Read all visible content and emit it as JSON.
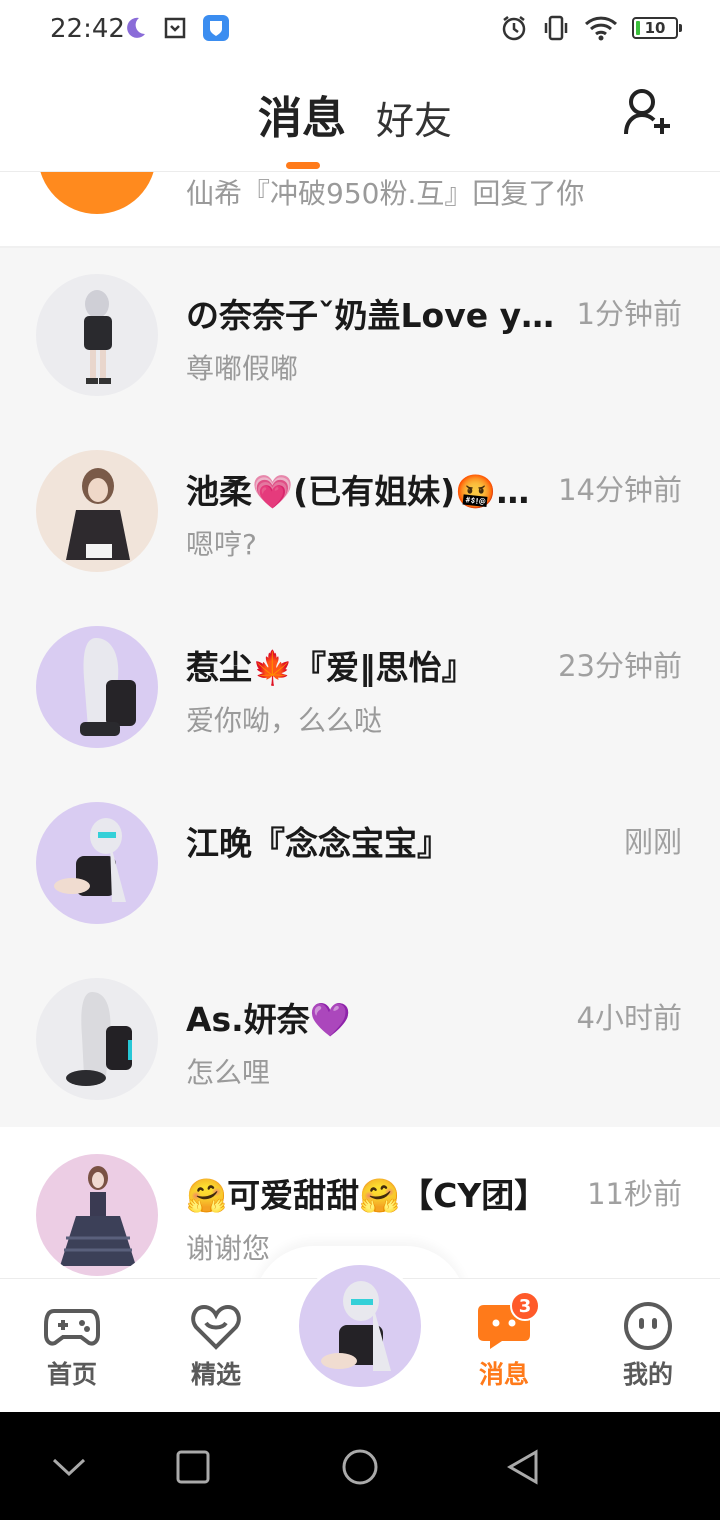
{
  "status_bar": {
    "time": "22:42",
    "battery_level": "10",
    "icons": [
      "moon-icon",
      "screenshot-icon",
      "shield-app-icon",
      "alarm-icon",
      "vibrate-icon",
      "wifi-icon",
      "battery-icon"
    ]
  },
  "header": {
    "tabs": [
      {
        "label": "消息",
        "active": true
      },
      {
        "label": "好友",
        "active": false
      }
    ],
    "add_friend_icon": "add-user-icon"
  },
  "colors": {
    "accent": "#ff7a1a",
    "badge": "#ff5a2a",
    "text_primary": "#1a1a1a",
    "text_secondary": "#9a9a9a",
    "list_bg": "#f6f6f6"
  },
  "partial_row": {
    "preview": "仙希『冲破950粉.互』回复了你"
  },
  "conversations": [
    {
      "name": "の奈奈子ˇ奶盖Love you",
      "time": "1分钟前",
      "message": "尊嘟假嘟"
    },
    {
      "name": "池柔💗(已有姐妹)🤬…",
      "time": "14分钟前",
      "message": "嗯哼?"
    },
    {
      "name": "惹尘🍁『爱‖思怡』",
      "time": "23分钟前",
      "message": "爱你呦，么么哒"
    },
    {
      "name": "江晚『念念宝宝』",
      "time": "刚刚",
      "message": ""
    },
    {
      "name": "As.妍奈💜",
      "time": "4小时前",
      "message": "怎么哩"
    },
    {
      "name": "🤗可爱甜甜🤗【CY团】",
      "time": "11秒前",
      "message": "谢谢您"
    }
  ],
  "bottom_nav": {
    "items": [
      {
        "label": "首页",
        "icon": "gamepad-icon"
      },
      {
        "label": "精选",
        "icon": "heart-chat-icon"
      },
      {
        "label": "消息",
        "icon": "message-bubble-icon",
        "badge": "3",
        "active": true
      },
      {
        "label": "我的",
        "icon": "face-icon"
      }
    ]
  },
  "system_nav": [
    "back-chevron-icon",
    "recents-square-icon",
    "home-circle-icon",
    "back-triangle-icon"
  ]
}
